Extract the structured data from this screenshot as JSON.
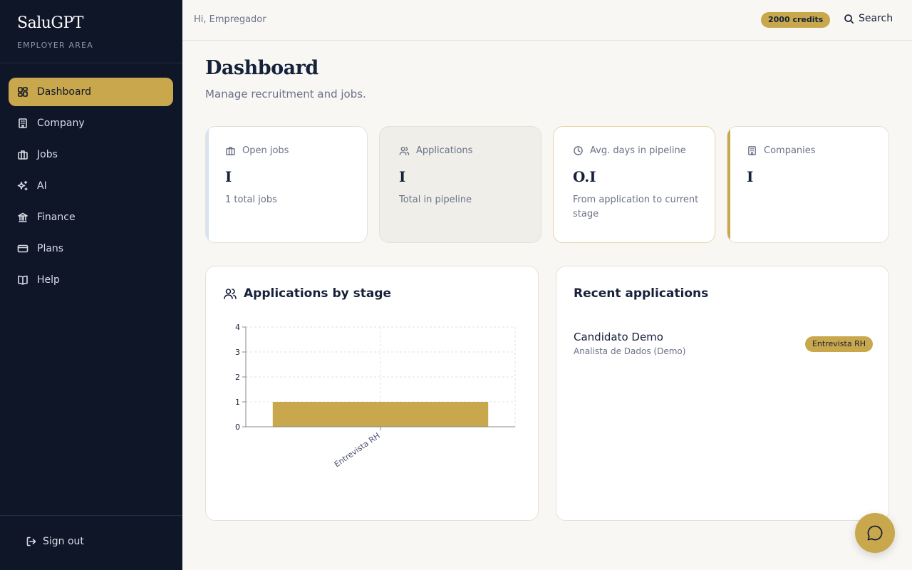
{
  "brand": {
    "name": "SaluGPT",
    "subtitle": "EMPLOYER AREA"
  },
  "sidebar": {
    "items": [
      {
        "label": "Dashboard",
        "icon": "dashboard-icon",
        "active": true
      },
      {
        "label": "Company",
        "icon": "building-icon"
      },
      {
        "label": "Jobs",
        "icon": "briefcase-icon"
      },
      {
        "label": "AI",
        "icon": "sparkles-icon"
      },
      {
        "label": "Finance",
        "icon": "bank-icon"
      },
      {
        "label": "Plans",
        "icon": "credit-card-icon"
      },
      {
        "label": "Help",
        "icon": "book-icon"
      }
    ],
    "signout_label": "Sign out"
  },
  "topbar": {
    "greeting": "Hi, Empregador",
    "credits": "2000 credits",
    "search_label": "Search"
  },
  "page": {
    "title": "Dashboard",
    "subtitle": "Manage recruitment and jobs."
  },
  "stats": [
    {
      "label": "Open jobs",
      "value": "I",
      "note": "1 total jobs",
      "icon": "briefcase-icon"
    },
    {
      "label": "Applications",
      "value": "I",
      "note": "Total in pipeline",
      "icon": "users-icon"
    },
    {
      "label": "Avg. days in pipeline",
      "value": "O.I",
      "note": "From application to current stage",
      "icon": "clock-icon"
    },
    {
      "label": "Companies",
      "value": "I",
      "note": "",
      "icon": "building-icon"
    }
  ],
  "panels": {
    "chart_title": "Applications by stage",
    "recent_title": "Recent applications"
  },
  "recent_applications": [
    {
      "name": "Candidato Demo",
      "role": "Analista de Dados (Demo)",
      "stage": "Entrevista RH"
    }
  ],
  "colors": {
    "sidebar_bg": "#0f1628",
    "accent": "#c9a74c",
    "page_bg": "#f8f7f4"
  },
  "chart_data": {
    "type": "bar",
    "categories": [
      "Entrevista RH"
    ],
    "values": [
      1
    ],
    "ylim": [
      0,
      4
    ],
    "yticks": [
      0,
      1,
      2,
      3,
      4
    ],
    "grid": true,
    "color": "#c9a74c"
  }
}
